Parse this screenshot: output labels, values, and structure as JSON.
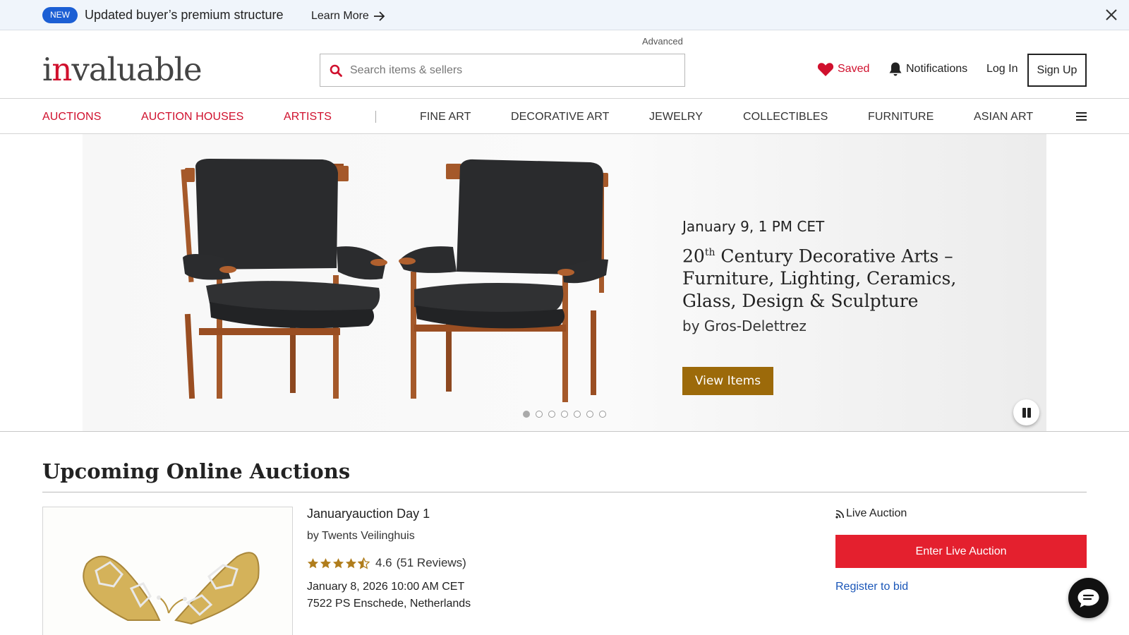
{
  "announcement": {
    "badge": "NEW",
    "message": "Updated buyer’s premium structure",
    "learn_more": "Learn More",
    "arrow_icon": "arrow-right-icon",
    "close_icon": "close-icon"
  },
  "header": {
    "logo_first": "i",
    "logo_red": "n",
    "logo_rest": "valuable",
    "advanced": "Advanced",
    "search_placeholder": "Search items & sellers",
    "search_value": "",
    "saved": "Saved",
    "notifications": "Notifications",
    "login": "Log In",
    "signup": "Sign Up"
  },
  "nav": {
    "primary": [
      "AUCTIONS",
      "AUCTION HOUSES",
      "ARTISTS"
    ],
    "categories": [
      "FINE ART",
      "DECORATIVE ART",
      "JEWELRY",
      "COLLECTIBLES",
      "FURNITURE",
      "ASIAN ART"
    ],
    "separator": "|",
    "menu_icon": "hamburger-menu-icon"
  },
  "hero": {
    "date": "January 9, 1 PM CET",
    "title_num": "20",
    "title_sup": "th",
    "title_rest": " Century Decorative Arts – Furniture, Lighting, Ceramics, Glass, Design & Sculpture",
    "by": "by Gros-Delettrez",
    "button": "View Items",
    "slide_count": 7,
    "active_slide": 1,
    "button_color": "#9c6a0a"
  },
  "upcoming": {
    "title": "Upcoming Online Auctions",
    "auction": {
      "name": "Januaryauction Day 1",
      "house": "by Twents Veilinghuis",
      "rating": "4.6",
      "reviews": "(51 Reviews)",
      "stars_value": 4.6,
      "date": "January 8, 2026 10:00 AM CET",
      "location": "7522 PS Enschede, Netherlands",
      "live_label": "Live Auction",
      "enter_button": "Enter Live Auction",
      "register": "Register to bid"
    }
  },
  "colors": {
    "brand_red": "#d0102d",
    "enter_red": "#e4202e",
    "badge_blue": "#1c5fd4",
    "link_blue": "#1a56b8",
    "star_gold": "#b07d1c"
  }
}
